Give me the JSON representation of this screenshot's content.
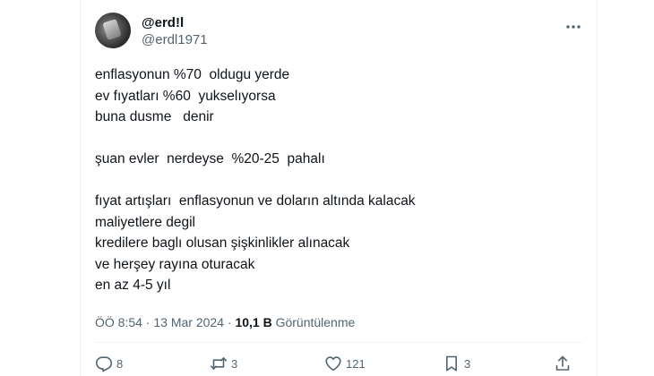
{
  "tweet": {
    "author": {
      "name": "@erd!l",
      "handle": "@erdl1971"
    },
    "lines": [
      "enflasyonun %70  oldugu yerde",
      "ev fıyatları %60  yukselıyorsa",
      "buna dusme   denir",
      "",
      "şuan evler  nerdeyse  %20-25  pahalı",
      "",
      "fıyat artışları  enflasyonun ve doların altında kalacak",
      "maliyetlere degil",
      "kredilere baglı olusan şişkinlikler alınacak",
      "ve herşey rayına oturacak",
      "en az 4-5 yıl"
    ],
    "meta": {
      "time": "ÖÖ 8:54",
      "separator": " · ",
      "date": "13 Mar 2024",
      "views_count": "10,1 B",
      "views_label": " Görüntülenme"
    },
    "actions": {
      "replies": "8",
      "reposts": "3",
      "likes": "121",
      "bookmarks": "3"
    }
  },
  "icons": {
    "more": "more-dots-icon",
    "reply": "reply-icon",
    "repost": "repost-icon",
    "like": "heart-icon",
    "bookmark": "bookmark-icon",
    "share": "share-icon"
  },
  "colors": {
    "text": "#0f1419",
    "muted": "#536471",
    "divider": "#eff3f4"
  }
}
